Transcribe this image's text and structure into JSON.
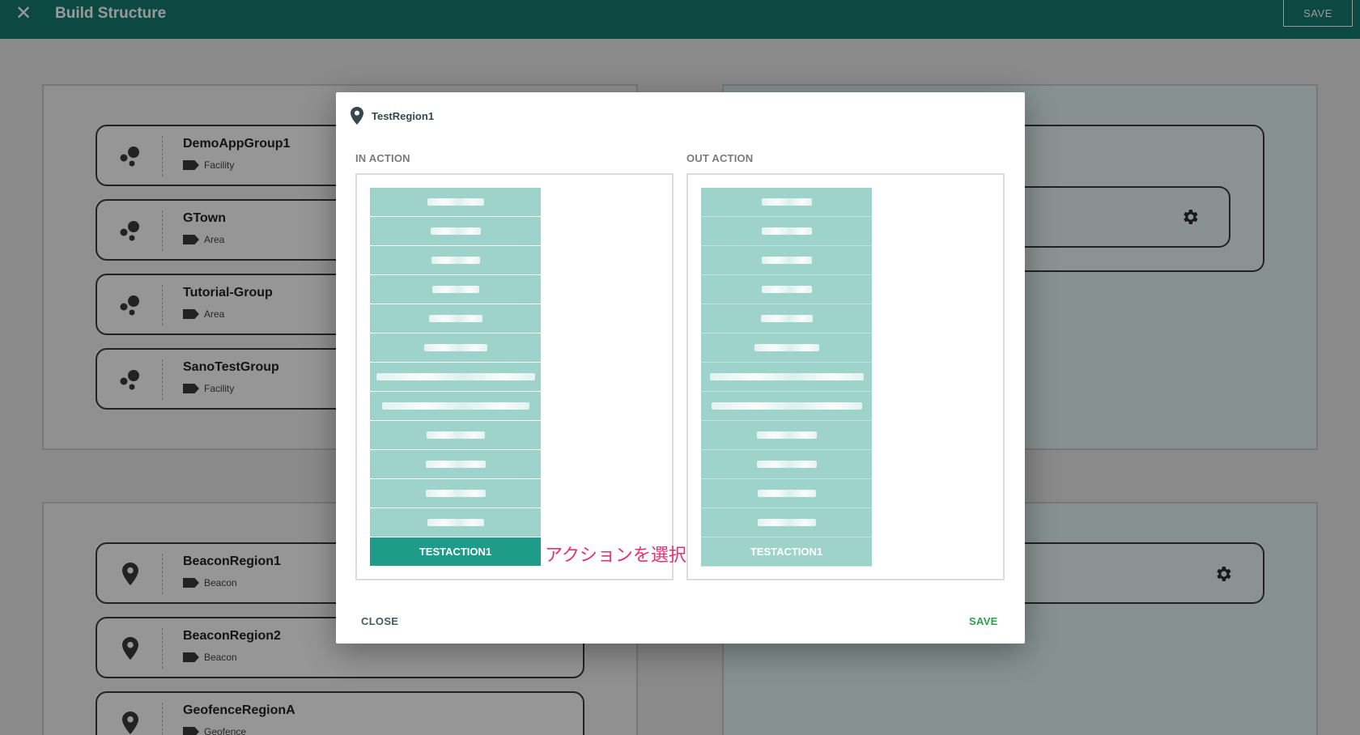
{
  "topbar": {
    "close_icon": "close-icon",
    "title": "Build Structure",
    "save_label": "SAVE"
  },
  "groups": [
    {
      "name": "DemoAppGroup1",
      "type": "Facility"
    },
    {
      "name": "GTown",
      "type": "Area"
    },
    {
      "name": "Tutorial-Group",
      "type": "Area"
    },
    {
      "name": "SanoTestGroup",
      "type": "Facility"
    }
  ],
  "regions": [
    {
      "name": "BeaconRegion1",
      "type": "Beacon"
    },
    {
      "name": "BeaconRegion2",
      "type": "Beacon"
    },
    {
      "name": "GeofenceRegionA",
      "type": "Geofence"
    }
  ],
  "dialog": {
    "title": "TestRegion1",
    "in_action": {
      "label": "IN ACTION",
      "selected": "TESTACTION1"
    },
    "out_action": {
      "label": "OUT ACTION",
      "last_item": "TESTACTION1"
    },
    "annotation": "アクションを選択",
    "close_label": "CLOSE",
    "save_label": "SAVE"
  },
  "colors": {
    "topbar": "#167a70",
    "item": "#9ed3cc",
    "item_selected": "#1f9b8a",
    "annotation": "#e8306e",
    "save_text": "#2e9e4f"
  }
}
